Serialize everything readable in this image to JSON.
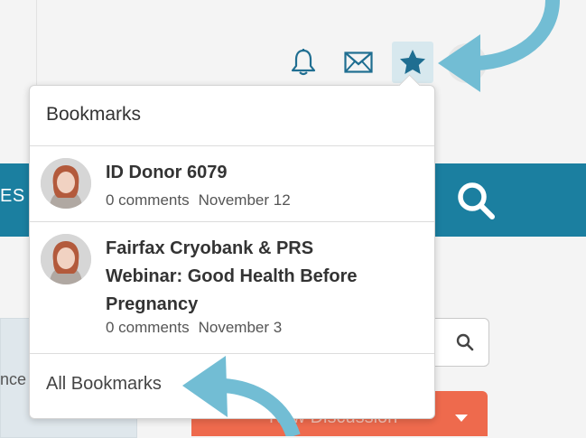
{
  "header": {
    "icons": [
      {
        "name": "bell-icon"
      },
      {
        "name": "envelope-icon"
      },
      {
        "name": "star-icon",
        "active": true
      }
    ]
  },
  "background": {
    "nav_partial_text": "ES",
    "left_card_partial_text": "nce",
    "new_discussion_label": "New Discussion"
  },
  "bookmarks_dropdown": {
    "title": "Bookmarks",
    "items": [
      {
        "title": "ID Donor 6079",
        "comments": "0 comments",
        "date": "November 12"
      },
      {
        "title": "Fairfax Cryobank & PRS Webinar: Good Health Before Pregnancy",
        "comments": "0 comments",
        "date": "November 3"
      }
    ],
    "footer_link": "All Bookmarks"
  },
  "colors": {
    "teal": "#1b7fa0",
    "icon_blue": "#1f6e91",
    "arrow": "#72bdd4",
    "new_discussion": "#ee6a4d"
  }
}
